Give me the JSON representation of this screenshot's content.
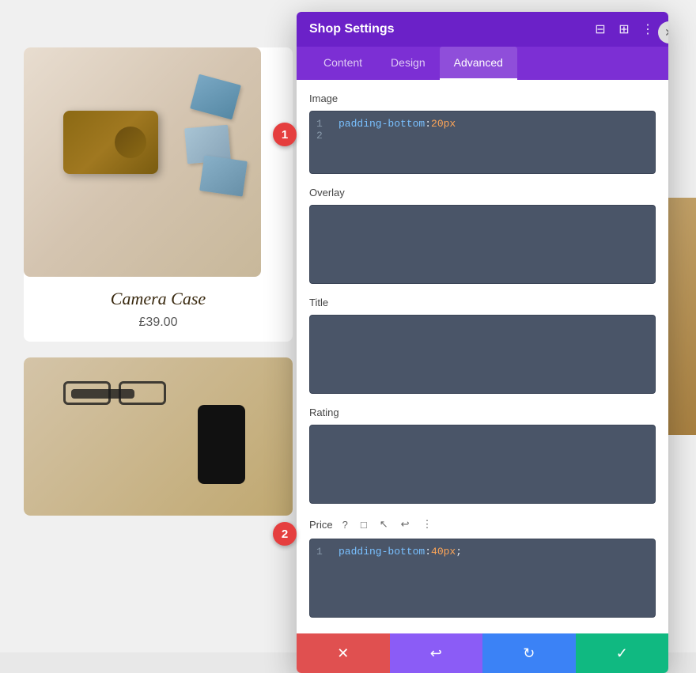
{
  "panel": {
    "title": "Shop Settings",
    "tabs": [
      {
        "id": "content",
        "label": "Content",
        "active": false
      },
      {
        "id": "design",
        "label": "Design",
        "active": false
      },
      {
        "id": "advanced",
        "label": "Advanced",
        "active": true
      }
    ],
    "sections": [
      {
        "id": "image",
        "label": "Image",
        "code_lines": [
          {
            "num": "1",
            "code": "padding-bottom: 20px"
          },
          {
            "num": "2",
            "code": ""
          }
        ]
      },
      {
        "id": "overlay",
        "label": "Overlay",
        "code_lines": []
      },
      {
        "id": "title",
        "label": "Title",
        "code_lines": []
      },
      {
        "id": "rating",
        "label": "Rating",
        "code_lines": []
      },
      {
        "id": "price",
        "label": "Price",
        "has_toolbar": true,
        "code_lines": [
          {
            "num": "1",
            "code": "padding-bottom: 40px;"
          }
        ]
      }
    ],
    "toolbar_icons": [
      "?",
      "□",
      "↖",
      "↩",
      "⋮"
    ],
    "action_bar": {
      "cancel_icon": "✕",
      "undo_icon": "↩",
      "redo_icon": "↻",
      "confirm_icon": "✓"
    }
  },
  "product": {
    "name": "Camera Case",
    "price": "£39.00"
  },
  "badges": {
    "badge1": "1",
    "badge2": "2"
  },
  "icons": {
    "minimize": "⊟",
    "split": "⊞",
    "more": "⋮",
    "close": "✕"
  }
}
